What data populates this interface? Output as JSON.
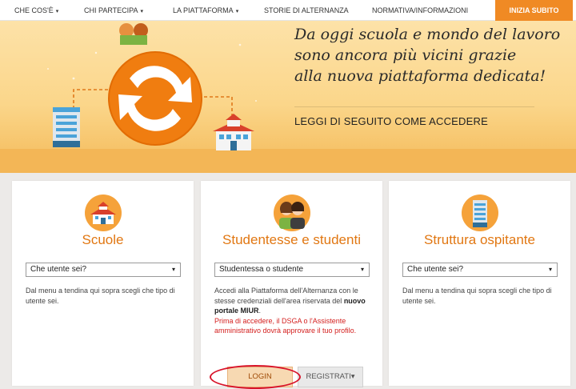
{
  "nav": {
    "items": [
      {
        "label": "CHE COS'È",
        "caret": "▾"
      },
      {
        "label": "CHI PARTECIPA",
        "caret": "▾"
      },
      {
        "label": "LA PIATTAFORMA",
        "caret": "▾"
      },
      {
        "label": "STORIE DI ALTERNANZA",
        "caret": ""
      },
      {
        "label": "NORMATIVA/INFORMAZIONI",
        "caret": ""
      }
    ],
    "cta": "INIZIA SUBITO"
  },
  "hero": {
    "tagline_lines": [
      "Da oggi scuola e mondo del lavoro",
      "sono ancora più vicini grazie",
      "alla nuova piattaforma dedicata!"
    ],
    "link": "LEGGI DI SEGUITO COME ACCEDERE"
  },
  "cards": [
    {
      "title": "Scuole",
      "icon": "school-icon",
      "select_value": "Che utente sei?",
      "text": "Dal menu a tendina qui sopra scegli che tipo di utente sei."
    },
    {
      "title": "Studentesse e studenti",
      "icon": "students-icon",
      "select_value": "Studentessa o studente",
      "text_before": "Accedi alla Piattaforma dell'Alternanza con le stesse credenziali dell'area riservata del ",
      "text_bold": "nuovo portale MIUR",
      "text_after": ".",
      "warning": "Prima di accedere, il DSGA o l'Assistente amministrativo dovrà approvare il tuo profilo.",
      "login_label": "LOGIN",
      "register_label": "REGISTRATI",
      "register_caret": "▾"
    },
    {
      "title": "Struttura ospitante",
      "icon": "building-icon",
      "select_value": "Che utente sei?",
      "text": "Dal menu a tendina qui sopra scegli che tipo di utente sei."
    }
  ],
  "select_caret": "▾",
  "colors": {
    "accent": "#f08a24",
    "title": "#e17712",
    "warning": "#d4201f",
    "annotation": "#d8142a"
  }
}
